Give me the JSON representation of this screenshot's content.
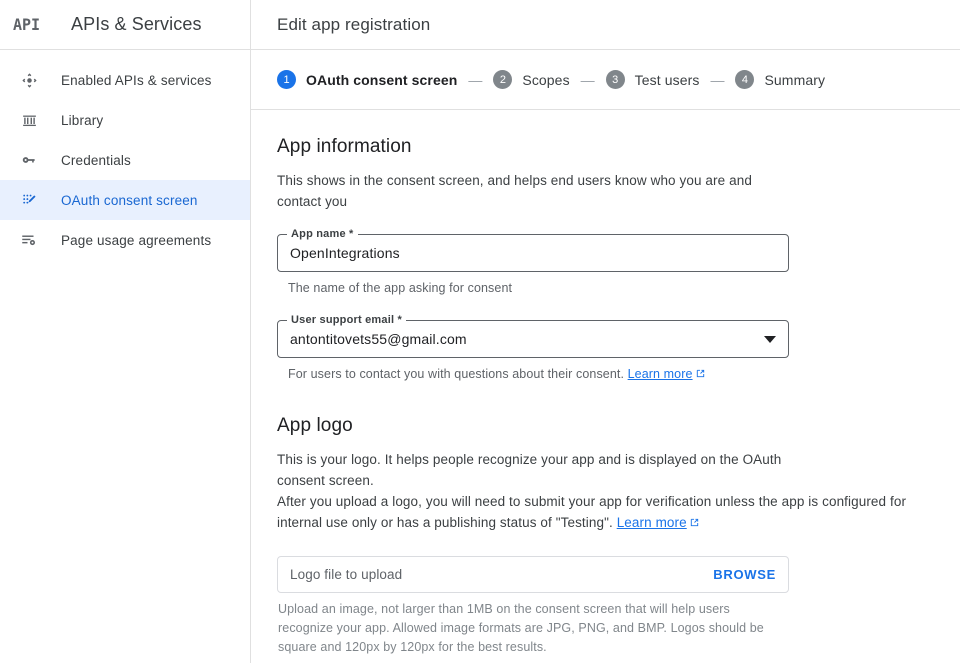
{
  "sidebar": {
    "logo_text": "API",
    "brand_title": "APIs & Services",
    "items": [
      {
        "label": "Enabled APIs & services",
        "icon": "api-dashboard-icon",
        "active": false
      },
      {
        "label": "Library",
        "icon": "library-icon",
        "active": false
      },
      {
        "label": "Credentials",
        "icon": "key-icon",
        "active": false
      },
      {
        "label": "OAuth consent screen",
        "icon": "oauth-consent-icon",
        "active": true
      },
      {
        "label": "Page usage agreements",
        "icon": "page-usage-agreements-icon",
        "active": false
      }
    ]
  },
  "header": {
    "title": "Edit app registration"
  },
  "stepper": {
    "separator": "—",
    "steps": [
      {
        "number": "1",
        "label": "OAuth consent screen",
        "current": true
      },
      {
        "number": "2",
        "label": "Scopes",
        "current": false
      },
      {
        "number": "3",
        "label": "Test users",
        "current": false
      },
      {
        "number": "4",
        "label": "Summary",
        "current": false
      }
    ]
  },
  "app_information": {
    "heading": "App information",
    "description": "This shows in the consent screen, and helps end users know who you are and contact you",
    "app_name": {
      "label": "App name *",
      "value": "OpenIntegrations",
      "placeholder": "App name",
      "helper": "The name of the app asking for consent"
    },
    "support_email": {
      "label": "User support email *",
      "value": "antontitovets55@gmail.com",
      "placeholder": "User support email",
      "helper": "For users to contact you with questions about their consent.",
      "helper_link": "Learn more"
    }
  },
  "app_logo": {
    "heading": "App logo",
    "description_line1": "This is your logo. It helps people recognize your app and is displayed on the OAuth consent screen.",
    "description_line2": "After you upload a logo, you will need to submit your app for verification unless the app is configured for internal use only or has a publishing status of \"Testing\".",
    "description_link": "Learn more",
    "upload_placeholder": "Logo file to upload",
    "browse_label": "BROWSE",
    "upload_helper": "Upload an image, not larger than 1MB on the consent screen that will help users recognize your app. Allowed image formats are JPG, PNG, and BMP. Logos should be square and 120px by 120px for the best results."
  },
  "colors": {
    "accent_blue": "#1a73e8",
    "active_nav_bg": "#e8f0fe",
    "active_nav_text": "#1967d2",
    "step_inactive": "#80868b",
    "border": "#dadce0",
    "text_primary": "#202124",
    "text_secondary": "#5f6368"
  }
}
